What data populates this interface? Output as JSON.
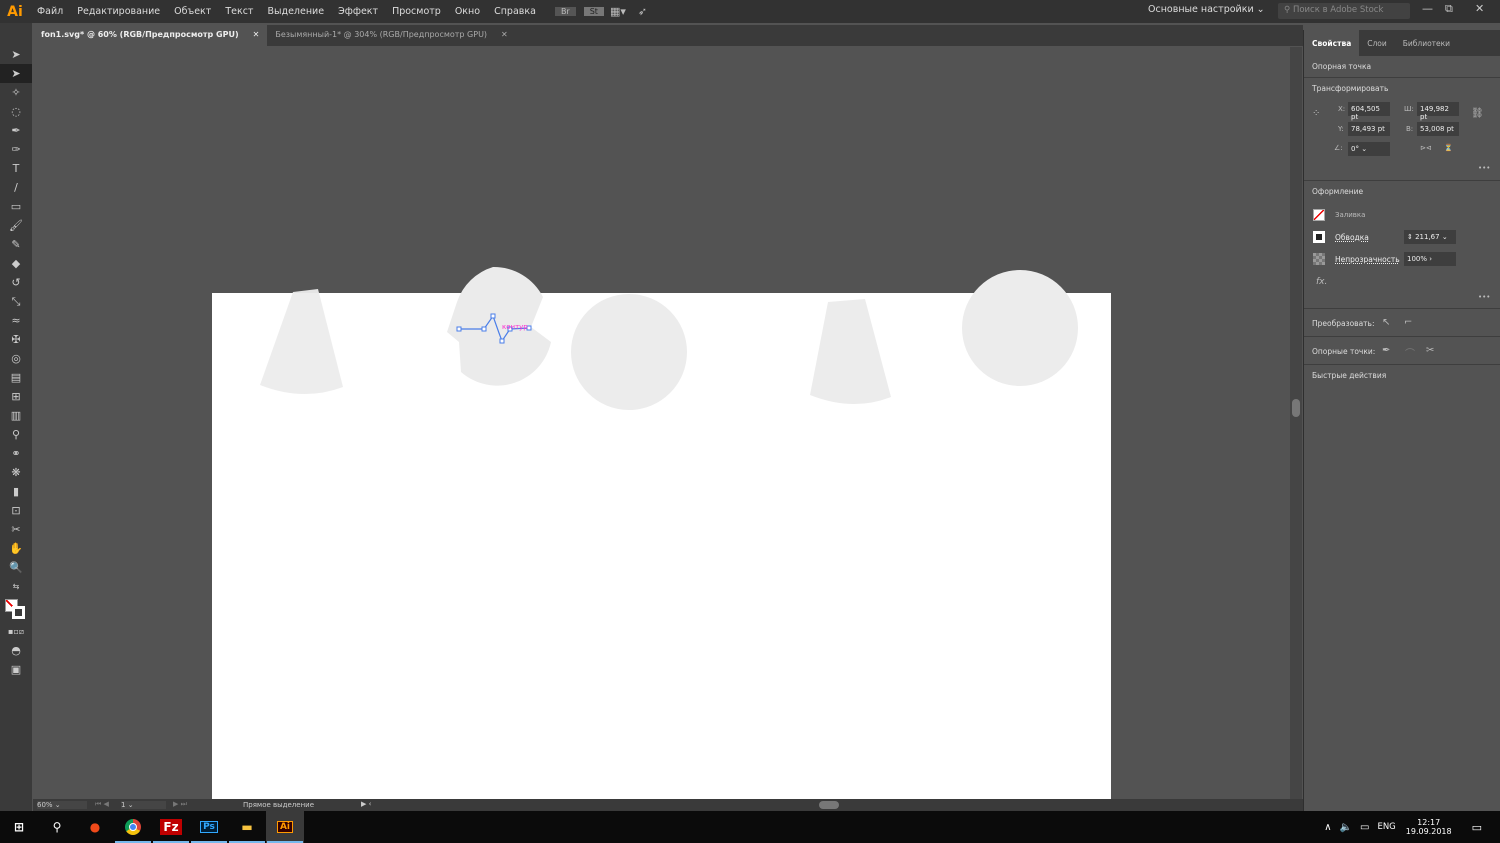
{
  "app": {
    "logo": "Ai",
    "menu": [
      "Файл",
      "Редактирование",
      "Объект",
      "Текст",
      "Выделение",
      "Эффект",
      "Просмотр",
      "Окно",
      "Справка"
    ],
    "toolbar_icons": [
      "Br",
      "St"
    ],
    "workspace": "Основные настройки",
    "search_placeholder": "Поиск в Adobe Stock"
  },
  "tabs": [
    {
      "label": "fon1.svg* @ 60% (RGB/Предпросмотр GPU)",
      "active": true
    },
    {
      "label": "Безымянный-1* @ 304% (RGB/Предпросмотр GPU)",
      "active": false
    }
  ],
  "canvas": {
    "path_label": "контур"
  },
  "status": {
    "zoom": "60%",
    "artboard": "1",
    "tool": "Прямое выделение"
  },
  "panel": {
    "tabs": [
      "Свойства",
      "Слои",
      "Библиотеки"
    ],
    "anchor_section": "Опорная точка",
    "transform": {
      "title": "Трансформировать",
      "x_label": "X:",
      "x": "604,505 pt",
      "w_label": "Ш:",
      "w": "149,982 pt",
      "y_label": "Y:",
      "y": "78,493 pt",
      "h_label": "В:",
      "h": "53,008 pt",
      "angle": "0°"
    },
    "appearance": {
      "title": "Оформление",
      "fill": "Заливка",
      "stroke": "Обводка",
      "stroke_value": "211,67",
      "opacity": "Непрозрачность",
      "opacity_value": "100%",
      "fx": "fx."
    },
    "convert": "Преобразовать:",
    "anchors": "Опорные точки:",
    "quick": "Быстрые действия"
  },
  "taskbar": {
    "lang": "ENG",
    "time": "12:17",
    "date": "19.09.2018",
    "apps": [
      "Ps",
      "Ai"
    ]
  },
  "colors": {
    "accent": "#ff9a00",
    "selection": "#4a7ee8",
    "label": "#ff2bd1"
  }
}
